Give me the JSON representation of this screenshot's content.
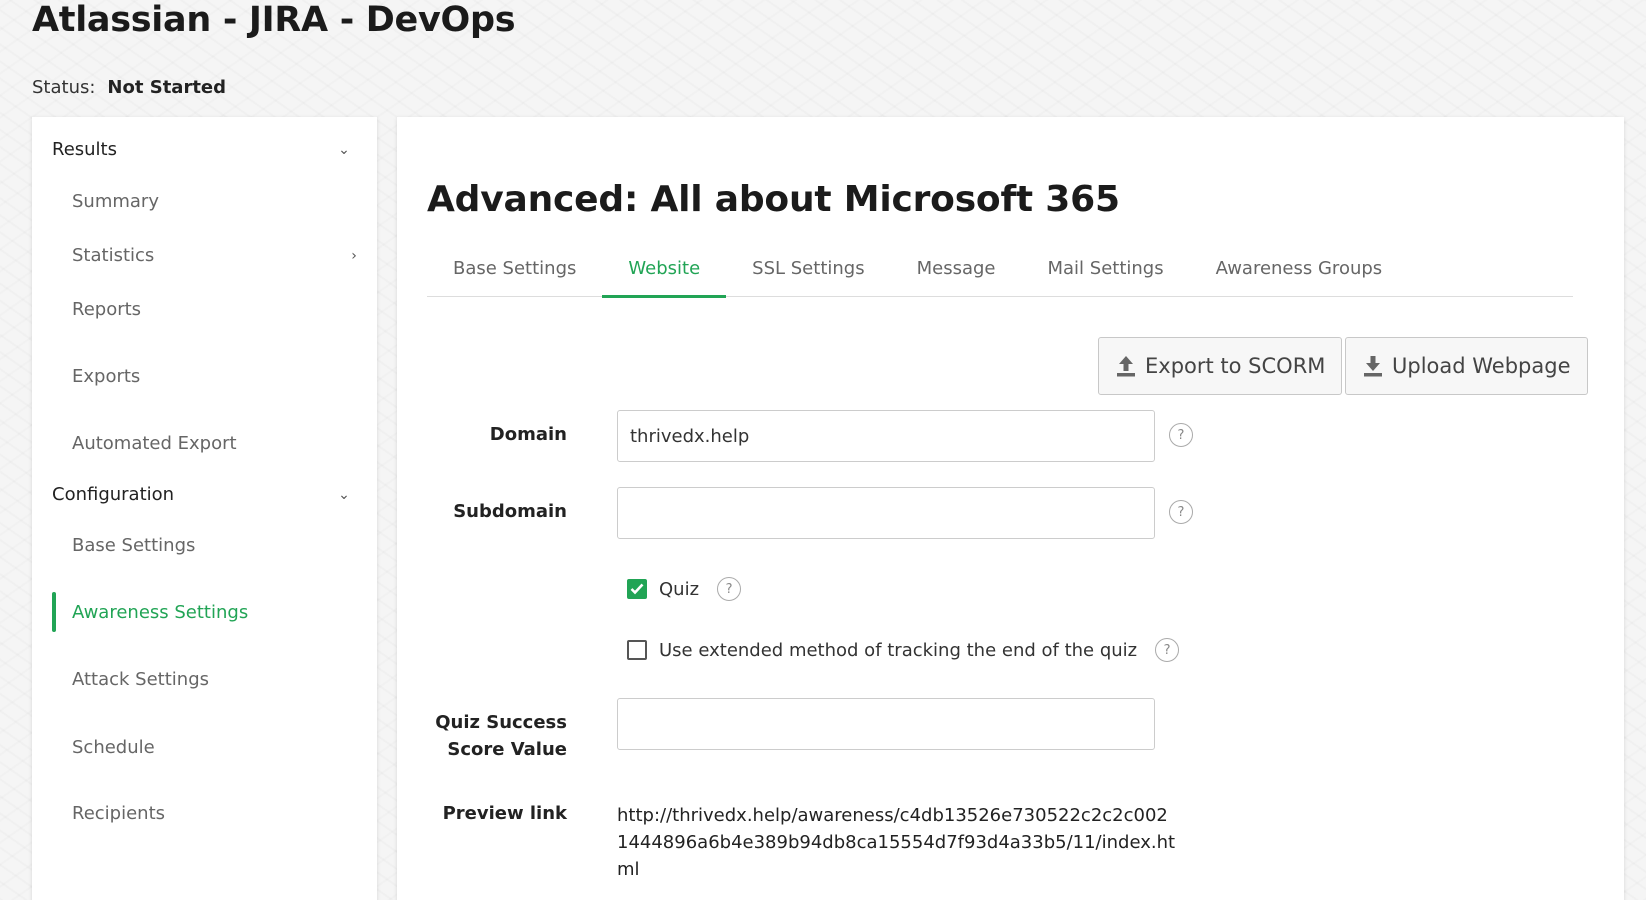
{
  "header": {
    "title": "Atlassian - JIRA - DevOps",
    "status_label": "Status:",
    "status_value": "Not Started"
  },
  "sidebar": {
    "results": {
      "label": "Results",
      "items": [
        {
          "label": "Summary"
        },
        {
          "label": "Statistics"
        },
        {
          "label": "Reports"
        },
        {
          "label": "Exports"
        },
        {
          "label": "Automated Export"
        }
      ]
    },
    "configuration": {
      "label": "Configuration",
      "items": [
        {
          "label": "Base Settings"
        },
        {
          "label": "Awareness Settings",
          "active": true
        },
        {
          "label": "Attack Settings"
        },
        {
          "label": "Schedule"
        },
        {
          "label": "Recipients"
        }
      ]
    }
  },
  "main": {
    "title": "Advanced: All about Microsoft 365",
    "tabs": [
      {
        "label": "Base Settings"
      },
      {
        "label": "Website",
        "active": true
      },
      {
        "label": "SSL Settings"
      },
      {
        "label": "Message"
      },
      {
        "label": "Mail Settings"
      },
      {
        "label": "Awareness Groups"
      }
    ],
    "buttons": {
      "export_scorm": "Export to SCORM",
      "upload_webpage": "Upload Webpage"
    },
    "form": {
      "domain_label": "Domain",
      "domain_value": "thrivedx.help",
      "subdomain_label": "Subdomain",
      "subdomain_value": "",
      "quiz_label": "Quiz",
      "quiz_checked": true,
      "extended_label": "Use extended method of tracking the end of the quiz",
      "extended_checked": false,
      "quiz_score_label": "Quiz Success Score Value",
      "quiz_score_value": "",
      "preview_label": "Preview link",
      "preview_value": "http://thrivedx.help/awareness/c4db13526e730522c2c2c0021444896a6b4e389b94db8ca15554d7f93d4a33b5/11/index.html"
    },
    "help_icon_glyph": "?"
  },
  "colors": {
    "accent": "#21a455"
  }
}
